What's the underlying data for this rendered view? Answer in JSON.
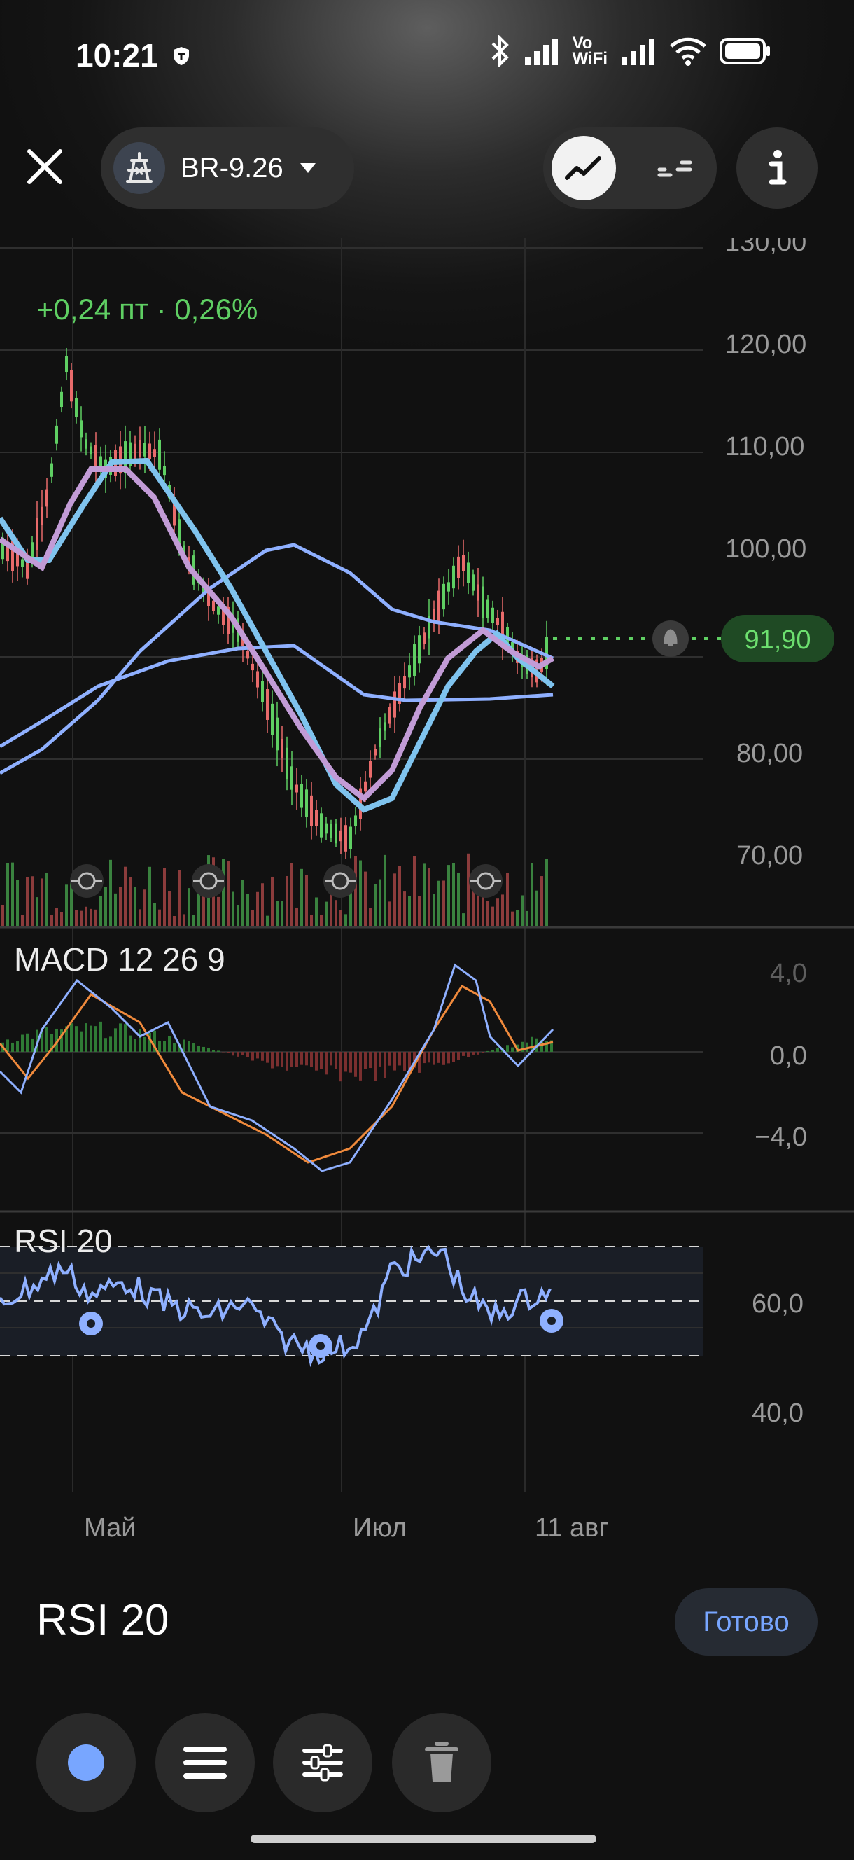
{
  "status_bar": {
    "time": "10:21",
    "volte": "Vo",
    "wifi_label": "WiFi"
  },
  "header": {
    "ticker": "BR-9.26"
  },
  "quote": {
    "change": "+0,24 пт · 0,26%",
    "last_price": "91,90"
  },
  "price_axis": [
    "130,00",
    "120,00",
    "110,00",
    "100,00",
    "80,00",
    "70,00"
  ],
  "macd": {
    "title": "MACD 12 26 9",
    "axis": [
      "4,0",
      "0,0",
      "−4,0"
    ]
  },
  "rsi": {
    "title": "RSI 20",
    "axis": [
      "60,0",
      "40,0"
    ]
  },
  "time_axis": [
    "Май",
    "Июл",
    "11 авг"
  ],
  "sheet": {
    "title": "RSI 20",
    "done_label": "Готово"
  },
  "colors": {
    "accent": "#78a6ff",
    "up": "#5fcf63",
    "down": "#e86b6b",
    "ma_fast": "#c29bd6",
    "ma_mid": "#7fc3ee",
    "ma_slow": "#8fb0ff",
    "macd_signal": "#f08a3c"
  },
  "icons": {
    "close": "close-icon",
    "ticker": "oil-rig-icon",
    "dropdown": "chevron-down-icon",
    "line_mode": "line-chart-icon",
    "candle_mode": "candles-icon",
    "info": "info-icon",
    "color": "color-dot-icon",
    "line_style": "line-style-icon",
    "settings": "sliders-icon",
    "delete": "trash-icon"
  }
}
